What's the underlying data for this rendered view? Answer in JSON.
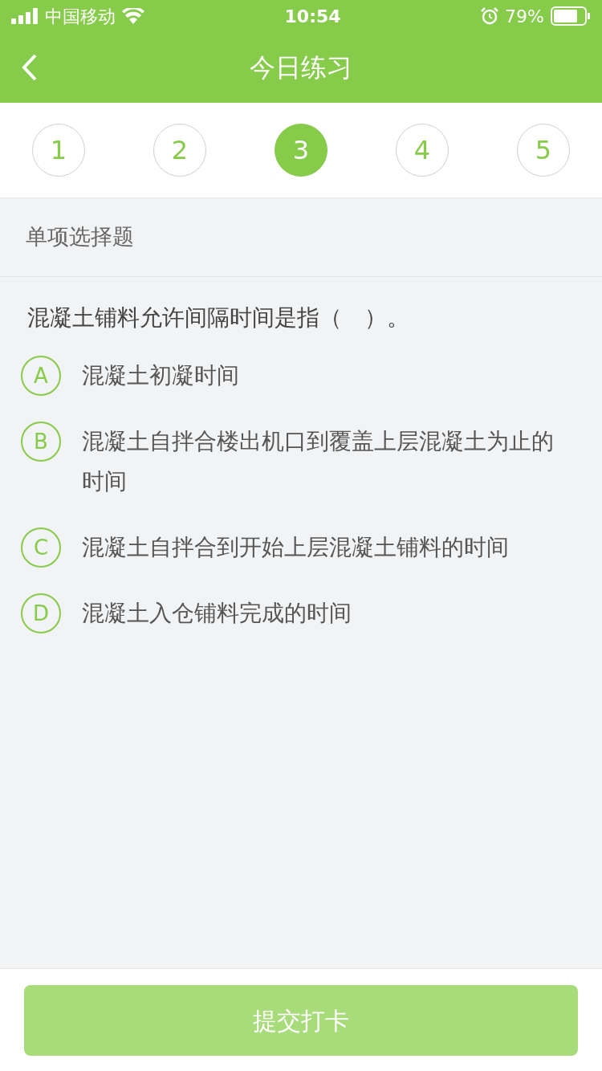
{
  "status_bar": {
    "carrier": "中国移动",
    "time": "10:54",
    "battery": "79%"
  },
  "header": {
    "title": "今日练习"
  },
  "steps": [
    {
      "label": "1",
      "selected": false
    },
    {
      "label": "2",
      "selected": false
    },
    {
      "label": "3",
      "selected": true
    },
    {
      "label": "4",
      "selected": false
    },
    {
      "label": "5",
      "selected": false
    }
  ],
  "section": "单项选择题",
  "question": {
    "text": "混凝土铺料允许间隔时间是指（　）。",
    "options": [
      {
        "letter": "A",
        "text": "混凝土初凝时间",
        "selected": false
      },
      {
        "letter": "B",
        "text": "混凝土自拌合楼出机口到覆盖上层混凝土为止的时间",
        "selected": false
      },
      {
        "letter": "C",
        "text": "混凝土自拌合到开始上层混凝土铺料的时间",
        "selected": false
      },
      {
        "letter": "D",
        "text": "混凝土入仓铺料完成的时间",
        "selected": false
      }
    ]
  },
  "submit": {
    "label": "提交打卡",
    "disabled": true
  }
}
